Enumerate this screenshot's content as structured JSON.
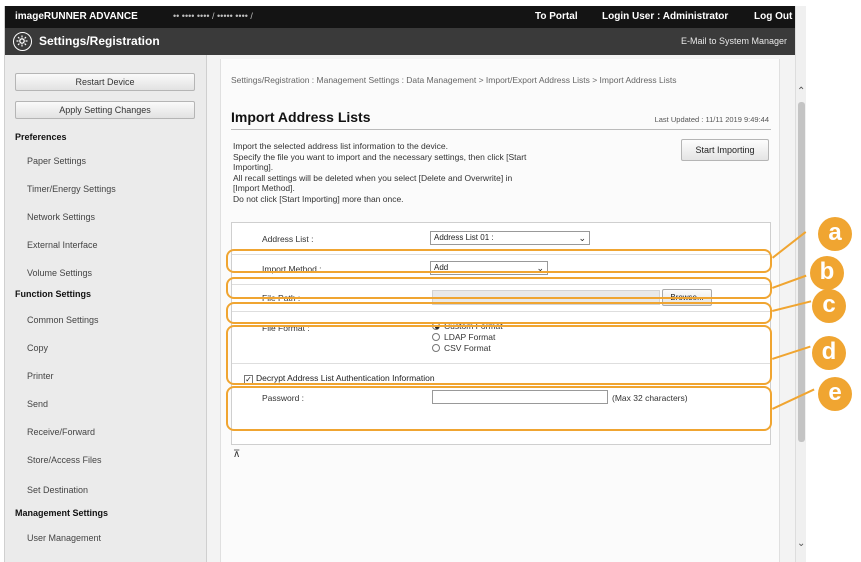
{
  "topbar": {
    "brand": "imageRUNNER ADVANCE",
    "url": "•• •••• •••• / ••••• •••• /",
    "to_portal": "To Portal",
    "login_user": "Login User : Administrator",
    "log_out": "Log Out"
  },
  "header": {
    "title": "Settings/Registration",
    "email_link": "E-Mail to System Manager"
  },
  "sidebar": {
    "restart_button": "Restart Device",
    "apply_button": "Apply Setting Changes",
    "sections": [
      {
        "heading": "Preferences",
        "items": [
          "Paper Settings",
          "Timer/Energy Settings",
          "Network Settings",
          "External Interface",
          "Volume Settings"
        ]
      },
      {
        "heading": "Function Settings",
        "items": [
          "Common Settings",
          "Copy",
          "Printer",
          "Send",
          "Receive/Forward",
          "Store/Access Files",
          "Set Destination"
        ]
      },
      {
        "heading": "Management Settings",
        "items": [
          "User Management"
        ]
      }
    ]
  },
  "main": {
    "breadcrumb": "Settings/Registration : Management Settings : Data Management > Import/Export Address Lists > Import Address Lists",
    "title": "Import Address Lists",
    "last_updated": "Last Updated : 11/11 2019 9:49:44",
    "start_button": "Start Importing",
    "description": [
      "Import the selected address list information to the device.",
      "Specify the file you want to import and the necessary settings, then click [Start",
      "Importing].",
      "All recall settings will be deleted when you select [Delete and Overwrite] in",
      "[Import Method].",
      "Do not click [Start Importing] more than once."
    ],
    "form": {
      "address_list_label": "Address List :",
      "address_list_value": "Address List 01 :",
      "import_method_label": "Import Method :",
      "import_method_value": "Add",
      "file_path_label": "File Path :",
      "browse_button": "Browse...",
      "file_format_label": "File Format :",
      "file_format_options": [
        "Custom Format",
        "LDAP Format",
        "CSV Format"
      ],
      "selected_format": "Custom Format",
      "decrypt_label": "Decrypt Address List Authentication Information",
      "decrypt_checked": true,
      "password_label": "Password :",
      "password_hint": "(Max 32 characters)"
    }
  },
  "callouts": [
    "a",
    "b",
    "c",
    "d",
    "e"
  ],
  "colors": {
    "callout": "#f0a531",
    "topbar": "#141414",
    "header": "#3a3a3a"
  }
}
